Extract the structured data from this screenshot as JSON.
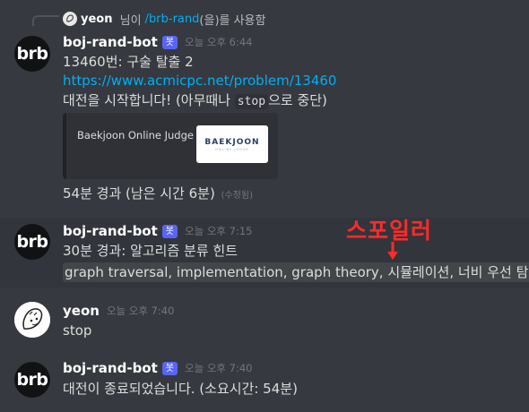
{
  "reply": {
    "name": "yeon",
    "suffix": " 님이 ",
    "command": "/brb-rand",
    "suffix2": "(을)를 사용함"
  },
  "messages": [
    {
      "author": "boj-rand-bot",
      "bot_tag": "봇",
      "timestamp": "오늘 오후 6:44",
      "line1": "13460번: 구술 탈출 2",
      "link": "https://www.acmicpc.net/problem/13460",
      "line3_pre": "대전을 시작합니다! (아무때나 ",
      "line3_code": "stop",
      "line3_post": "으로 중단)",
      "embed": {
        "provider": "Baekjoon Online Judge",
        "thumb_logo": "BAEKJOON",
        "thumb_sub": "ONLINE JUDGE"
      },
      "line4": "54분 경과 (남은 시간 6분)",
      "edited": "(수정됨)"
    },
    {
      "author": "boj-rand-bot",
      "bot_tag": "봇",
      "timestamp": "오늘 오후 7:15",
      "line1": "30분 경과: 알고리즘 분류 힌트",
      "spoiler": "graph traversal, implementation, graph theory, 시뮬레이션, 너비 우선 탐색"
    },
    {
      "author": "yeon",
      "timestamp": "오늘 오후 7:40",
      "line1": "stop"
    },
    {
      "author": "boj-rand-bot",
      "bot_tag": "봇",
      "timestamp": "오늘 오후 7:40",
      "line1": "대전이 종료되었습니다. (소요시간: 54분)"
    }
  ],
  "avatar_text": "brb",
  "annotation": {
    "label": "스포일러",
    "color": "#ff2a2a"
  },
  "colors": {
    "background": "#36393f",
    "link": "#00aff4",
    "bot_tag": "#5865f2"
  }
}
